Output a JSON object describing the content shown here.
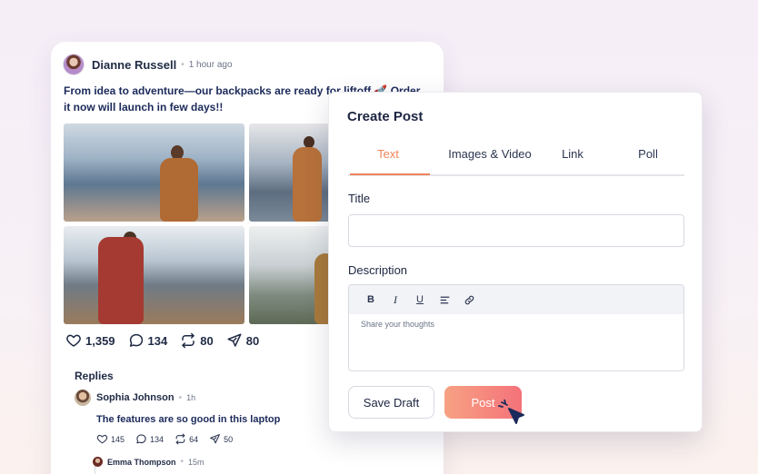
{
  "post": {
    "author": "Dianne Russell",
    "separator": "•",
    "time": "1 hour ago",
    "text": "From idea to adventure—our backpacks are ready for liftoff 🚀 Order it now will launch in few days!!",
    "actions": [
      {
        "icon": "heart-icon",
        "count": "1,359"
      },
      {
        "icon": "comment-icon",
        "count": "134"
      },
      {
        "icon": "repost-icon",
        "count": "80"
      },
      {
        "icon": "send-icon",
        "count": "80"
      }
    ],
    "replies_title": "Replies",
    "reply": {
      "author": "Sophia Johnson",
      "separator": "•",
      "time": "1h",
      "text": "The features are so good in this laptop",
      "actions": [
        {
          "icon": "heart-icon",
          "count": "145"
        },
        {
          "icon": "comment-icon",
          "count": "134"
        },
        {
          "icon": "repost-icon",
          "count": "64"
        },
        {
          "icon": "send-icon",
          "count": "50"
        }
      ]
    },
    "subreply": {
      "author": "Emma Thompson",
      "separator": "•",
      "time": "15m"
    }
  },
  "modal": {
    "title": "Create Post",
    "tabs": [
      {
        "label": "Text",
        "active": true
      },
      {
        "label": "Images & Video",
        "active": false
      },
      {
        "label": "Link",
        "active": false
      },
      {
        "label": "Poll",
        "active": false
      }
    ],
    "title_label": "Title",
    "title_value": "",
    "description_label": "Description",
    "toolbar": {
      "bold": "B",
      "italic": "I",
      "underline": "U"
    },
    "description_placeholder": "Share your thoughts",
    "save_draft_label": "Save Draft",
    "post_label": "Post"
  },
  "colors": {
    "accent": "#f0845a",
    "post_button_start": "#f7a283",
    "post_button_end": "#f4727a",
    "text_dark": "#1c2541"
  }
}
